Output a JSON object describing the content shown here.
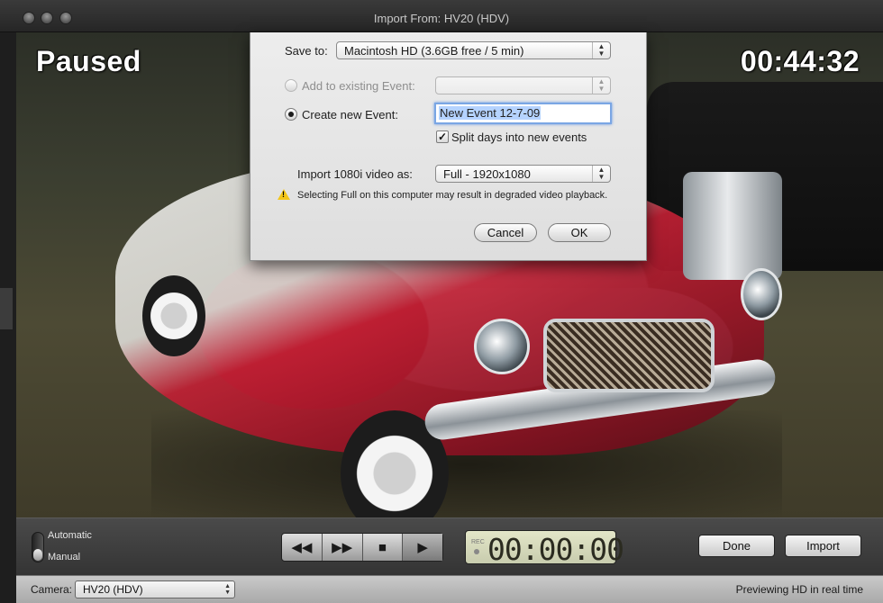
{
  "window": {
    "title": "Import From: HV20 (HDV)"
  },
  "video": {
    "status": "Paused",
    "timecode": "00:44:32"
  },
  "dialog": {
    "save_to_label": "Save to:",
    "save_to_value": "Macintosh HD (3.6GB free / 5 min)",
    "add_existing_label": "Add to existing Event:",
    "add_existing_value": "",
    "create_new_label": "Create new Event:",
    "new_event_value": "New Event 12-7-09",
    "split_days_label": "Split days into new events",
    "split_days_checked": true,
    "import_label": "Import 1080i video as:",
    "import_value": "Full - 1920x1080",
    "warning_text": "Selecting Full on this computer may result in degraded video playback.",
    "cancel_label": "Cancel",
    "ok_label": "OK"
  },
  "controls": {
    "mode_automatic": "Automatic",
    "mode_manual": "Manual",
    "rec_label": "REC",
    "counter": "00:00:00",
    "done_label": "Done",
    "import_label": "Import"
  },
  "statusbar": {
    "camera_label": "Camera:",
    "camera_value": "HV20 (HDV)",
    "message": "Previewing HD in real time"
  },
  "icons": {
    "rewind": "rewind-icon",
    "fast_forward": "fast-forward-icon",
    "stop": "stop-icon",
    "play": "play-icon",
    "warning": "warning-icon"
  },
  "colors": {
    "warning": "#f3c61a",
    "focus_ring": "#7aa6e4",
    "selection": "#b5d3ff"
  }
}
